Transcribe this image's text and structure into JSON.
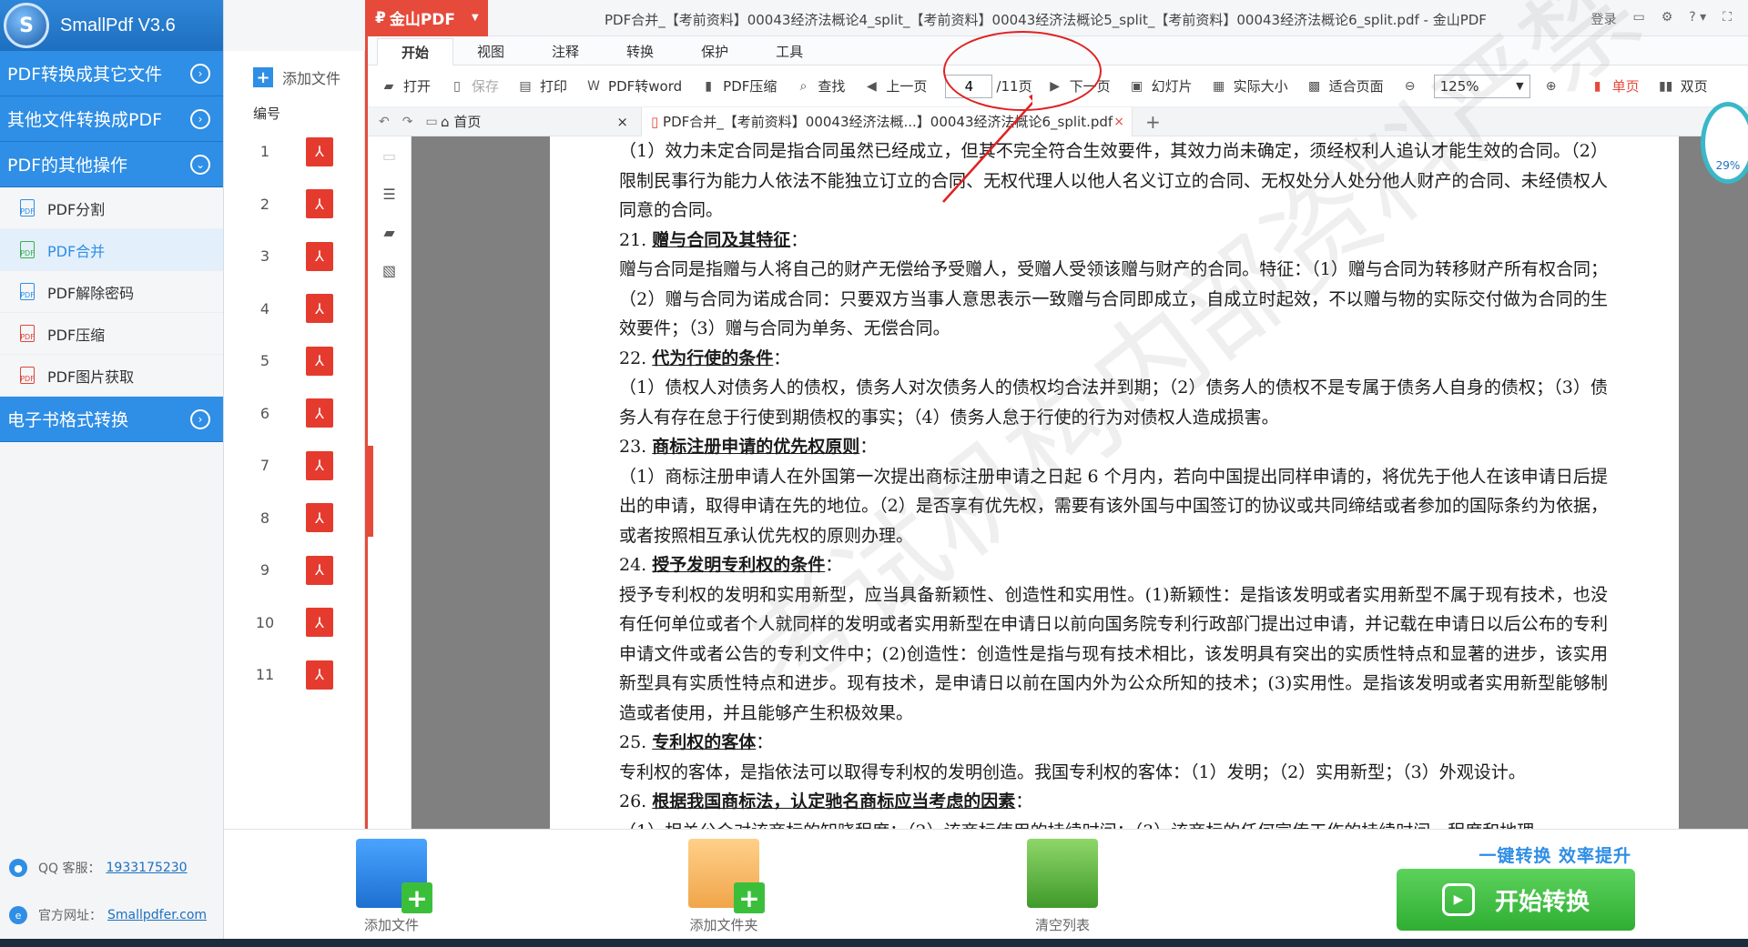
{
  "app": {
    "title": "SmallPdf V3.6",
    "logo_letter": "S"
  },
  "sidebar": {
    "sections": [
      {
        "label": "PDF转换成其它文件",
        "icon": "chevron-right-icon"
      },
      {
        "label": "其他文件转换成PDF",
        "icon": "chevron-right-icon"
      },
      {
        "label": "PDF的其他操作",
        "icon": "chevron-down-icon"
      }
    ],
    "subitems": [
      {
        "label": "PDF分割"
      },
      {
        "label": "PDF合并"
      },
      {
        "label": "PDF解除密码"
      },
      {
        "label": "PDF压缩"
      },
      {
        "label": "PDF图片获取"
      }
    ],
    "last_section": "电子书格式转换",
    "contact": {
      "qq_label": "QQ 客服：",
      "qq_value": "1933175230",
      "site_label": "官方网址：",
      "site_value": "Smallpdfer.com"
    }
  },
  "filelist": {
    "add_label": "添加文件",
    "column_header": "编号",
    "rows": [
      "1",
      "2",
      "3",
      "4",
      "5",
      "6",
      "7",
      "8",
      "9",
      "10",
      "11"
    ]
  },
  "wps": {
    "brand": "金山PDF",
    "doc_title": "PDF合并_【考前资料】00043经济法概论4_split_【考前资料】00043经济法概论5_split_【考前资料】00043经济法概论6_split.pdf - 金山PDF",
    "window_controls": [
      "登录",
      "▭",
      "⚙",
      "? ▾",
      "⛶"
    ],
    "tabs": [
      "开始",
      "视图",
      "注释",
      "转换",
      "保护",
      "工具"
    ],
    "toolbar": {
      "open": "打开",
      "save": "保存",
      "print": "打印",
      "to_word": "PDF转word",
      "compress": "PDF压缩",
      "find": "查找",
      "prev": "上一页",
      "page_current": "4",
      "page_total": "/11页",
      "next": "下一页",
      "slideshow": "幻灯片",
      "actual_size": "实际大小",
      "fit_page": "适合页面",
      "zoom": "125%",
      "single": "单页",
      "double": "双页"
    },
    "doctabs": {
      "home": "首页",
      "file": "PDF合并_【考前资料】00043经济法概...】00043经济法概论6_split.pdf",
      "new_tab": "+"
    },
    "page_lines": [
      {
        "type": "p",
        "text": "（1）效力未定合同是指合同虽然已经成立，但其不完全符合生效要件，其效力尚未确定，须经权利人追认才能生效的合同。（2）限制民事行为能力人依法不能独立订立的合同、无权代理人以他人名义订立的合同、无权处分人处分他人财产的合同、未经债权人同意的合同。"
      },
      {
        "type": "h",
        "num": "21.",
        "text": "赠与合同及其特征",
        "tail": "："
      },
      {
        "type": "p",
        "text": "赠与合同是指赠与人将自己的财产无偿给予受赠人，受赠人受领该赠与财产的合同。特征：（1）赠与合同为转移财产所有权合同；（2）赠与合同为诺成合同：只要双方当事人意思表示一致赠与合同即成立，自成立时起效，不以赠与物的实际交付做为合同的生效要件；（3）赠与合同为单务、无偿合同。"
      },
      {
        "type": "h",
        "num": "22.",
        "text": "代为行使的条件",
        "tail": "："
      },
      {
        "type": "p",
        "text": "（1）债权人对债务人的债权，债务人对次债务人的债权均合法并到期；（2）债务人的债权不是专属于债务人自身的债权；（3）债务人有存在怠于行使到期债权的事实；（4）债务人怠于行使的行为对债权人造成损害。"
      },
      {
        "type": "h",
        "num": "23.",
        "text": "商标注册申请的优先权原则",
        "tail": "："
      },
      {
        "type": "p",
        "text": "（1）商标注册申请人在外国第一次提出商标注册申请之日起 6 个月内，若向中国提出同样申请的，将优先于他人在该申请日后提出的申请，取得申请在先的地位。（2）是否享有优先权，需要有该外国与中国签订的协议或共同缔结或者参加的国际条约为依据，或者按照相互承认优先权的原则办理。"
      },
      {
        "type": "h",
        "num": "24.",
        "text": "授予发明专利权的条件",
        "tail": "："
      },
      {
        "type": "p",
        "text": "授予专利权的发明和实用新型，应当具备新颖性、创造性和实用性。(1)新颖性：是指该发明或者实用新型不属于现有技术，也没有任何单位或者个人就同样的发明或者实用新型在申请日以前向国务院专利行政部门提出过申请，并记载在申请日以后公布的专利申请文件或者公告的专利文件中；(2)创造性：创造性是指与现有技术相比，该发明具有突出的实质性特点和显著的进步，该实用新型具有实质性特点和进步。现有技术，是申请日以前在国内外为公众所知的技术；(3)实用性。是指该发明或者实用新型能够制造或者使用，并且能够产生积极效果。"
      },
      {
        "type": "h",
        "num": "25.",
        "text": "专利权的客体",
        "tail": "："
      },
      {
        "type": "p",
        "text": "专利权的客体，是指依法可以取得专利权的发明创造。我国专利权的客体：（1）发明；（2）实用新型；（3）外观设计。"
      },
      {
        "type": "h",
        "num": "26.",
        "text": "根据我国商标法，认定驰名商标应当考虑的因素",
        "tail": "："
      },
      {
        "type": "p",
        "text": "（1）相关公众对该商标的知晓程度；（2）该商标使用的持续时间；（3）该商标的任何宣传工作的持续时间、程度和地理"
      }
    ],
    "watermark": "考试机构内部资料严禁"
  },
  "gauge": {
    "value": "29%"
  },
  "bottom": {
    "actions": [
      {
        "label": "添加文件"
      },
      {
        "label": "添加文件夹"
      },
      {
        "label": "清空列表"
      }
    ],
    "slogan": "一键转换  效率提升",
    "start_label": "开始转换"
  }
}
